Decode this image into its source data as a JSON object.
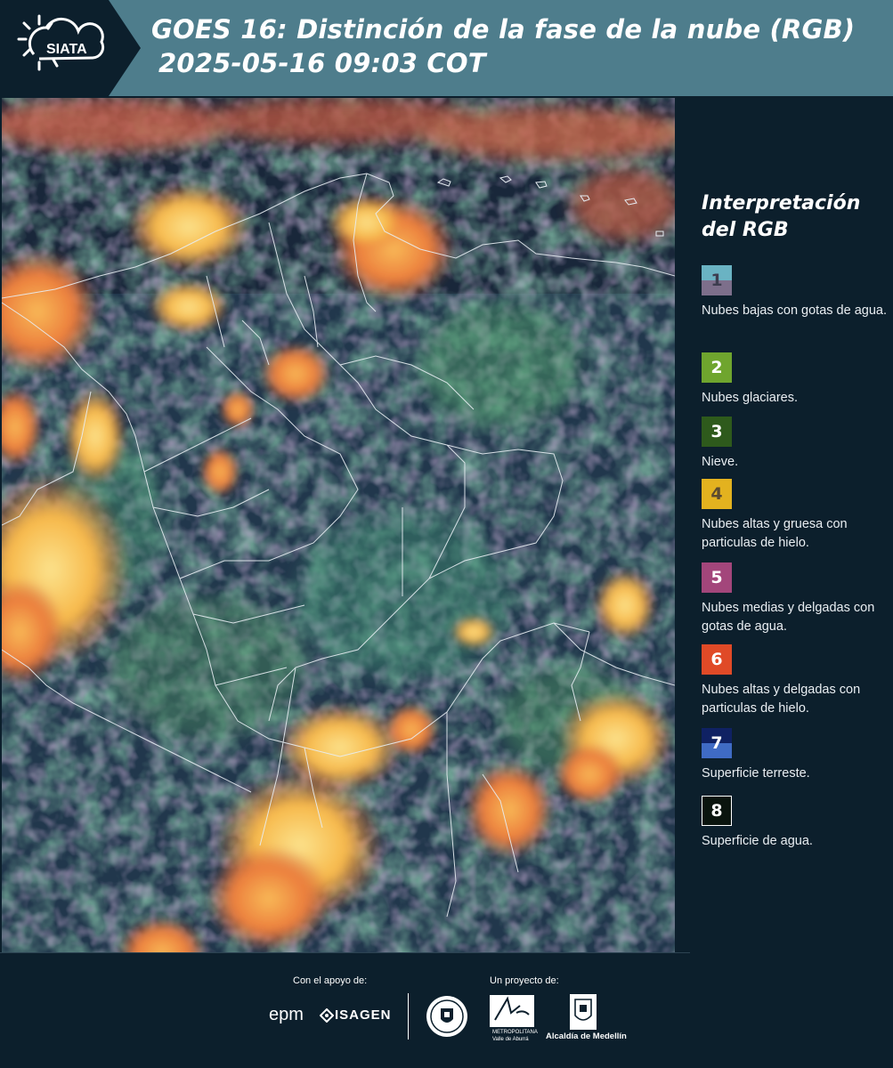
{
  "header": {
    "logo_text": "SIATA",
    "title_line1": "GOES 16: Distinción de la fase de la nube (RGB)",
    "title_line2": "2025-05-16 09:03 COT"
  },
  "legend": {
    "title": "Interpretación del RGB",
    "items": [
      {
        "num": "1",
        "label": "Nubes bajas con gotas de agua.",
        "top_color": "#6ab3c3",
        "bottom_color": "#7d6f8b",
        "num_color": "#3d3d4f"
      },
      {
        "num": "2",
        "label": "Nubes glaciares.",
        "top_color": "#6fa52e",
        "bottom_color": "#6fa52e",
        "num_color": "#ffffff"
      },
      {
        "num": "3",
        "label": "Nieve.",
        "top_color": "#2e5a1c",
        "bottom_color": "#2e5a1c",
        "num_color": "#ffffff"
      },
      {
        "num": "4",
        "label": "Nubes altas y gruesa con particulas de hielo.",
        "top_color": "#e3b21f",
        "bottom_color": "#e3b21f",
        "num_color": "#5a4a30"
      },
      {
        "num": "5",
        "label": "Nubes medias y delgadas con gotas de agua.",
        "top_color": "#a3467b",
        "bottom_color": "#a3467b",
        "num_color": "#ffffff"
      },
      {
        "num": "6",
        "label": "Nubes altas y delgadas con particulas de hielo.",
        "top_color": "#e04a27",
        "bottom_color": "#e04a27",
        "num_color": "#ffffff"
      },
      {
        "num": "7",
        "label": "Superficie terreste.",
        "top_color": "#0f2163",
        "bottom_color": "#3f6bc4",
        "num_color": "#ffffff"
      },
      {
        "num": "8",
        "label": "Superficie de agua.",
        "top_color": "#0a140e",
        "bottom_color": "#0a140e",
        "num_color": "#ffffff"
      }
    ]
  },
  "footer": {
    "support_label": "Con el apoyo de:",
    "project_label": "Un proyecto de:",
    "epm_text": "epm",
    "isagen_text": "ISAGEN",
    "area_text_line1": "METROPOLITANA",
    "area_text_line2": "Valle de Aburrá",
    "alcaldia_text": "Alcaldía de Medellín"
  },
  "colors": {
    "header_bg": "#4e7d8c",
    "page_bg": "#0c1f2c",
    "cloud_orange": "#f6a43a",
    "cloud_yellow": "#f7d26a",
    "cloud_green": "#6fbf4a",
    "surface_blue": "#1d2f4c"
  }
}
